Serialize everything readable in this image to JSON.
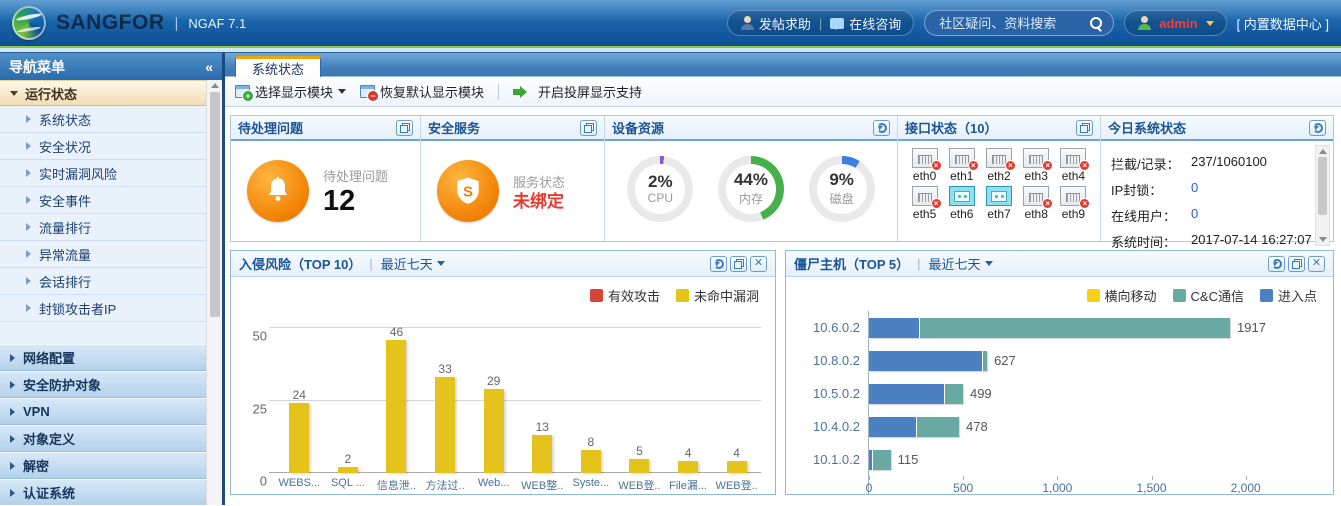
{
  "header": {
    "brand": "SANGFOR",
    "divider": "|",
    "product": "NGAF 7.1",
    "post_help": "发帖求助",
    "online_chat": "在线咨询",
    "search_placeholder": "社区疑问、资料搜索",
    "username": "admin",
    "datacenter": "[ 内置数据中心 ]"
  },
  "sidebar": {
    "title": "导航菜单",
    "collapse_icon": "«",
    "active_group": "运行状态",
    "active_items": [
      "系统状态",
      "安全状况",
      "实时漏洞风险",
      "安全事件",
      "流量排行",
      "异常流量",
      "会话排行",
      "封锁攻击者IP"
    ],
    "groups": [
      "网络配置",
      "安全防护对象",
      "VPN",
      "对象定义",
      "解密",
      "认证系统"
    ]
  },
  "tabs": [
    {
      "label": "系统状态"
    }
  ],
  "toolbar": {
    "select_modules": "选择显示模块",
    "restore_default": "恢复默认显示模块",
    "projection": "开启投屏显示支持"
  },
  "panels": {
    "pending": {
      "title": "待处理问题",
      "label": "待处理问题",
      "value": "12"
    },
    "service": {
      "title": "安全服务",
      "label": "服务状态",
      "value": "未绑定",
      "value_color": "#e43a30"
    },
    "resources": {
      "title": "设备资源",
      "gauges": [
        {
          "value": "2%",
          "label": "CPU",
          "percent": 2,
          "color": "#8a56c0"
        },
        {
          "value": "44%",
          "label": "内存",
          "percent": 44,
          "color": "#47b04b"
        },
        {
          "value": "9%",
          "label": "磁盘",
          "percent": 9,
          "color": "#3b7fe0"
        }
      ]
    },
    "interfaces": {
      "title": "接口状态（10）",
      "ports": [
        {
          "name": "eth0",
          "up": false
        },
        {
          "name": "eth1",
          "up": false
        },
        {
          "name": "eth2",
          "up": false
        },
        {
          "name": "eth3",
          "up": false
        },
        {
          "name": "eth4",
          "up": false
        },
        {
          "name": "eth5",
          "up": false
        },
        {
          "name": "eth6",
          "up": true
        },
        {
          "name": "eth7",
          "up": true
        },
        {
          "name": "eth8",
          "up": false
        },
        {
          "name": "eth9",
          "up": false
        }
      ]
    },
    "today": {
      "title": "今日系统状态",
      "rows": [
        {
          "label": "拦截/记录：",
          "value": "237/1060100",
          "highlight": false
        },
        {
          "label": "IP封锁：",
          "value": "0",
          "highlight": true
        },
        {
          "label": "在线用户：",
          "value": "0",
          "highlight": true
        },
        {
          "label": "系统时间：",
          "value": "2017-07-14 16:27:07",
          "highlight": false
        }
      ]
    }
  },
  "chart_data": [
    {
      "type": "bar",
      "title": "入侵风险（TOP 10）",
      "period": "最近七天",
      "legend": [
        {
          "label": "有效攻击",
          "color": "#d6453c"
        },
        {
          "label": "未命中漏洞",
          "color": "#e4c41a"
        }
      ],
      "categories": [
        "WEBS...",
        "SQL ...",
        "信息泄..",
        "方法过..",
        "Web...",
        "WEB整..",
        "Syste...",
        "WEB登..",
        "File漏...",
        "WEB登.."
      ],
      "series": [
        {
          "name": "有效攻击",
          "color": "#d6453c",
          "values": [
            0,
            0,
            0,
            0,
            0,
            0,
            0,
            0,
            0,
            0
          ]
        },
        {
          "name": "未命中漏洞",
          "color": "#e4c41a",
          "values": [
            24,
            2,
            46,
            33,
            29,
            13,
            8,
            5,
            4,
            4
          ]
        }
      ],
      "ylim": [
        0,
        50
      ],
      "yticks": [
        0,
        25,
        50
      ],
      "grid": true,
      "legend_position": "top-right"
    },
    {
      "type": "stacked-horizontal-bar",
      "title": "僵尸主机（TOP 5）",
      "period": "最近七天",
      "legend": [
        {
          "label": "横向移动",
          "color": "#f3d213"
        },
        {
          "label": "C&C通信",
          "color": "#68aaa3"
        },
        {
          "label": "进入点",
          "color": "#4b80c2"
        }
      ],
      "categories": [
        "10.6.0.2",
        "10.8.0.2",
        "10.5.0.2",
        "10.4.0.2",
        "10.1.0.2"
      ],
      "series": [
        {
          "name": "进入点",
          "color": "#4b80c2",
          "values": [
            265,
            600,
            400,
            250,
            15
          ]
        },
        {
          "name": "C&C通信",
          "color": "#68aaa3",
          "values": [
            1652,
            27,
            99,
            228,
            100
          ]
        },
        {
          "name": "横向移动",
          "color": "#f3d213",
          "values": [
            0,
            0,
            0,
            0,
            0
          ]
        }
      ],
      "totals": [
        1917,
        627,
        499,
        478,
        115
      ],
      "xlim": [
        0,
        2400
      ],
      "xticks": [
        {
          "label": "0",
          "value": 0
        },
        {
          "label": "500",
          "value": 500
        },
        {
          "label": "1,000",
          "value": 1000
        },
        {
          "label": "1,500",
          "value": 1500
        },
        {
          "label": "2,000",
          "value": 2000
        }
      ],
      "legend_position": "top-right"
    }
  ]
}
